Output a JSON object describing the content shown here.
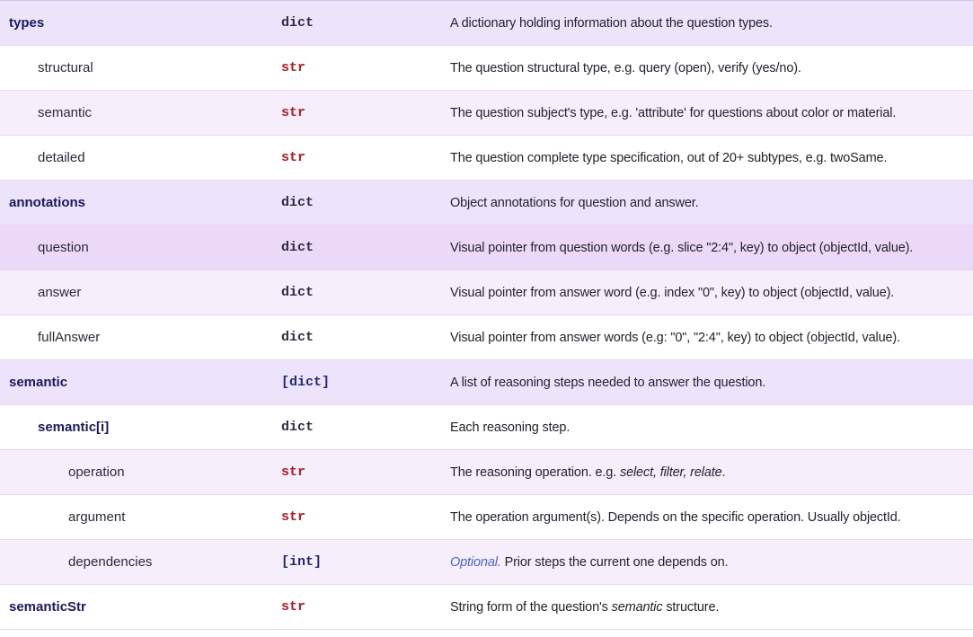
{
  "rows": [
    {
      "field": "types",
      "type": "dict",
      "desc": "A dictionary holding information about the question types."
    },
    {
      "field": "structural",
      "type": "str",
      "desc": "The question structural type, e.g. query (open), verify (yes/no)."
    },
    {
      "field": "semantic",
      "type": "str",
      "desc": "The question subject's type, e.g. 'attribute' for questions about color or material."
    },
    {
      "field": "detailed",
      "type": "str",
      "desc": "The question complete type specification, out of 20+ subtypes, e.g. twoSame."
    },
    {
      "field": "annotations",
      "type": "dict",
      "desc": "Object annotations for question and answer."
    },
    {
      "field": "question",
      "type": "dict",
      "desc": "Visual pointer from question words (e.g. slice \"2:4\", key) to object (objectId, value)."
    },
    {
      "field": "answer",
      "type": "dict",
      "desc": "Visual pointer from answer word (e.g. index \"0\", key) to object (objectId, value)."
    },
    {
      "field": "fullAnswer",
      "type": "dict",
      "desc": "Visual pointer from answer words (e.g: \"0\", \"2:4\", key) to object (objectId, value)."
    },
    {
      "field": "semantic",
      "type": "[dict]",
      "desc": "A list of reasoning steps needed to answer the question."
    },
    {
      "field": "semantic[i]",
      "type": "dict",
      "desc": "Each reasoning step."
    },
    {
      "field": "operation",
      "type": "str",
      "desc_pre": "The reasoning operation. e.g. ",
      "desc_em": "select, filter, relate",
      "desc_post": "."
    },
    {
      "field": "argument",
      "type": "str",
      "desc": "The operation argument(s). Depends on the specific operation. Usually objectId."
    },
    {
      "field": "dependencies",
      "type": "[int]",
      "desc_opt": "Optional.",
      "desc_post": " Prior steps the current one depends on."
    },
    {
      "field": "semanticStr",
      "type": "str",
      "desc_pre": "String form of the question's ",
      "desc_em": "semantic",
      "desc_post": " structure."
    }
  ]
}
